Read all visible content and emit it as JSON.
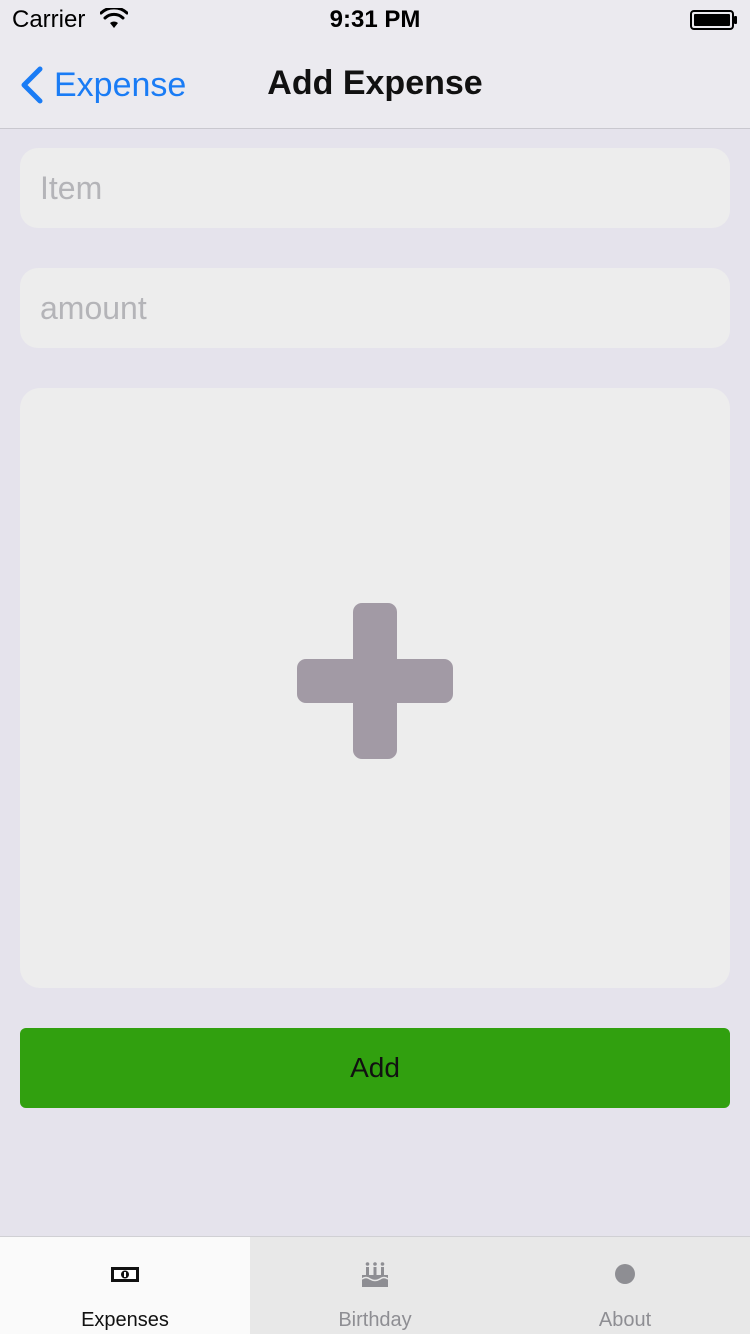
{
  "status_bar": {
    "carrier": "Carrier",
    "time": "9:31 PM",
    "icons": [
      "wifi-icon",
      "battery-icon"
    ]
  },
  "nav": {
    "back_label": "Expense",
    "title": "Add Expense"
  },
  "form": {
    "item": {
      "value": "",
      "placeholder": "Item"
    },
    "amount": {
      "value": "",
      "placeholder": "amount"
    },
    "photo_icon": "plus-icon",
    "add_label": "Add"
  },
  "tabs": [
    {
      "label": "Expenses",
      "icon": "money-icon",
      "active": true
    },
    {
      "label": "Birthday",
      "icon": "cake-icon",
      "active": false
    },
    {
      "label": "About",
      "icon": "circle-icon",
      "active": false
    }
  ],
  "colors": {
    "accent": "#1a7cf5",
    "add_button": "#31a00f",
    "background": "#e5e3ec",
    "plus_icon": "#a29aa5"
  }
}
